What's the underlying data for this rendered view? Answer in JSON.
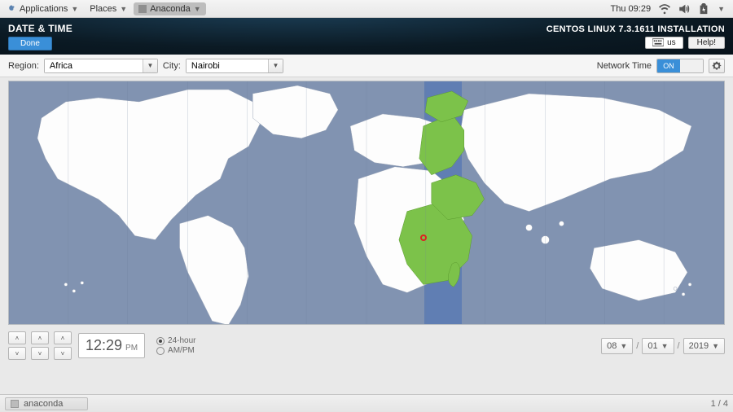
{
  "panel": {
    "apps": "Applications",
    "places": "Places",
    "active_app": "Anaconda",
    "clock": "Thu 09:29"
  },
  "header": {
    "title": "DATE & TIME",
    "done": "Done",
    "brand": "CENTOS LINUX 7.3.1611 INSTALLATION",
    "kb_layout": "us",
    "help": "Help!"
  },
  "filters": {
    "region_label": "Region:",
    "region_value": "Africa",
    "city_label": "City:",
    "city_value": "Nairobi",
    "ntp_label": "Network Time",
    "ntp_on": "ON"
  },
  "time": {
    "display": "12:29",
    "ampm": "PM",
    "fmt24": "24-hour",
    "fmtap": "AM/PM"
  },
  "date": {
    "month": "08",
    "day": "01",
    "year": "2019"
  },
  "taskbar": {
    "app": "anaconda",
    "pager": "1 / 4"
  }
}
